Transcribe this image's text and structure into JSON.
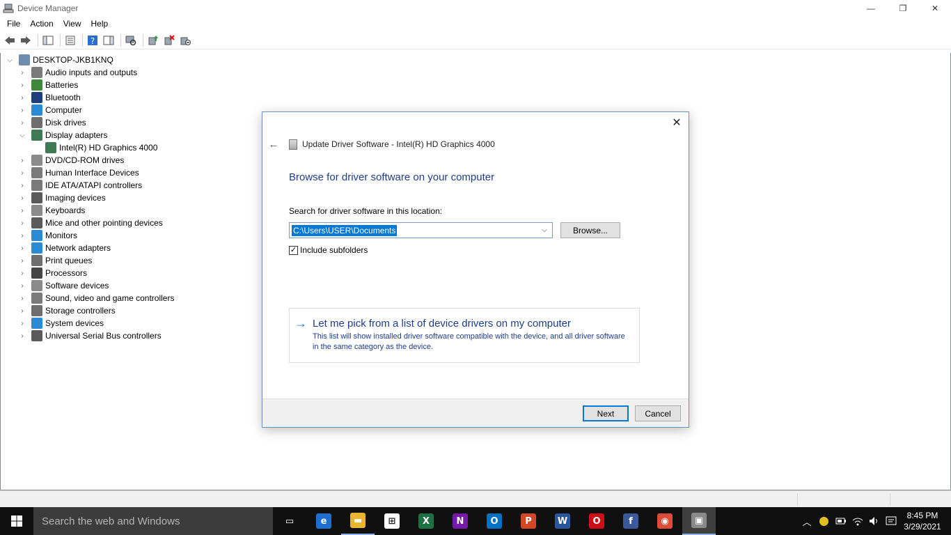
{
  "window": {
    "title": "Device Manager",
    "controls": {
      "minimize": "—",
      "restore": "❐",
      "close": "✕"
    }
  },
  "menu": [
    "File",
    "Action",
    "View",
    "Help"
  ],
  "toolbar": {
    "icons": [
      "back-icon",
      "forward-icon",
      "show-hide-console-tree-icon",
      "properties-icon",
      "help-icon",
      "show-hide-action-pane-icon",
      "scan-hardware-changes-icon",
      "update-driver-icon",
      "uninstall-device-icon",
      "disable-device-icon"
    ]
  },
  "tree": {
    "root": "DESKTOP-JKB1KNQ",
    "items": [
      {
        "label": "Audio inputs and outputs",
        "icon": "speaker-icon",
        "color": "#7a7a7a",
        "expanded": false
      },
      {
        "label": "Batteries",
        "icon": "battery-icon",
        "color": "#3d8a3d",
        "expanded": false
      },
      {
        "label": "Bluetooth",
        "icon": "bluetooth-icon",
        "color": "#1d3f7a",
        "expanded": false
      },
      {
        "label": "Computer",
        "icon": "monitor-icon",
        "color": "#2a8ad4",
        "expanded": false
      },
      {
        "label": "Disk drives",
        "icon": "disk-drive-icon",
        "color": "#6e6e6e",
        "expanded": false
      },
      {
        "label": "Display adapters",
        "icon": "display-adapter-icon",
        "color": "#3f7a52",
        "expanded": true
      },
      {
        "label": "Intel(R) HD Graphics 4000",
        "icon": "display-adapter-icon",
        "color": "#3f7a52",
        "child": true
      },
      {
        "label": "DVD/CD-ROM drives",
        "icon": "dvd-drive-icon",
        "color": "#8a8a8a",
        "expanded": false
      },
      {
        "label": "Human Interface Devices",
        "icon": "hid-icon",
        "color": "#7a7a7a",
        "expanded": false
      },
      {
        "label": "IDE ATA/ATAPI controllers",
        "icon": "ide-controller-icon",
        "color": "#7a7a7a",
        "expanded": false
      },
      {
        "label": "Imaging devices",
        "icon": "camera-icon",
        "color": "#5a5a5a",
        "expanded": false
      },
      {
        "label": "Keyboards",
        "icon": "keyboard-icon",
        "color": "#8a8a8a",
        "expanded": false
      },
      {
        "label": "Mice and other pointing devices",
        "icon": "mouse-icon",
        "color": "#5a5a5a",
        "expanded": false
      },
      {
        "label": "Monitors",
        "icon": "monitor-icon",
        "color": "#2a8ad4",
        "expanded": false
      },
      {
        "label": "Network adapters",
        "icon": "network-adapter-icon",
        "color": "#2a8ad4",
        "expanded": false
      },
      {
        "label": "Print queues",
        "icon": "printer-icon",
        "color": "#6e6e6e",
        "expanded": false
      },
      {
        "label": "Processors",
        "icon": "processor-icon",
        "color": "#444444",
        "expanded": false
      },
      {
        "label": "Software devices",
        "icon": "software-device-icon",
        "color": "#8a8a8a",
        "expanded": false
      },
      {
        "label": "Sound, video and game controllers",
        "icon": "speaker-icon",
        "color": "#7a7a7a",
        "expanded": false
      },
      {
        "label": "Storage controllers",
        "icon": "storage-controller-icon",
        "color": "#6e6e6e",
        "expanded": false
      },
      {
        "label": "System devices",
        "icon": "system-device-icon",
        "color": "#2a8ad4",
        "expanded": false
      },
      {
        "label": "Universal Serial Bus controllers",
        "icon": "usb-icon",
        "color": "#5a5a5a",
        "expanded": false
      }
    ]
  },
  "dialog": {
    "header": "Update Driver Software - Intel(R) HD Graphics 4000",
    "heading": "Browse for driver software on your computer",
    "search_label": "Search for driver software in this location:",
    "path_value": "C:\\Users\\USER\\Documents",
    "browse_label": "Browse...",
    "include_subfolders_label": "Include subfolders",
    "include_subfolders_checked": true,
    "option_title": "Let me pick from a list of device drivers on my computer",
    "option_desc": "This list will show installed driver software compatible with the device, and all driver software in the same category as the device.",
    "next_label": "Next",
    "cancel_label": "Cancel"
  },
  "taskbar": {
    "search_placeholder": "Search the web and Windows",
    "apps": [
      {
        "name": "task-view",
        "glyph": "▭",
        "bg": "transparent"
      },
      {
        "name": "edge",
        "glyph": "e",
        "bg": "#1f6fd0"
      },
      {
        "name": "file-explorer",
        "glyph": "▬",
        "bg": "#e8b530"
      },
      {
        "name": "store",
        "glyph": "⊞",
        "bg": "#ffffff"
      },
      {
        "name": "excel",
        "glyph": "X",
        "bg": "#1e7145"
      },
      {
        "name": "onenote",
        "glyph": "N",
        "bg": "#7719aa"
      },
      {
        "name": "outlook",
        "glyph": "O",
        "bg": "#0072c6"
      },
      {
        "name": "powerpoint",
        "glyph": "P",
        "bg": "#d24726"
      },
      {
        "name": "word",
        "glyph": "W",
        "bg": "#2b579a"
      },
      {
        "name": "opera",
        "glyph": "O",
        "bg": "#cc0f16"
      },
      {
        "name": "facebook",
        "glyph": "f",
        "bg": "#3b5998"
      },
      {
        "name": "chrome",
        "glyph": "◉",
        "bg": "#dd4b39"
      },
      {
        "name": "device-manager",
        "glyph": "▣",
        "bg": "#8a8a8a"
      }
    ],
    "time": "8:45 PM",
    "date": "3/29/2021"
  }
}
